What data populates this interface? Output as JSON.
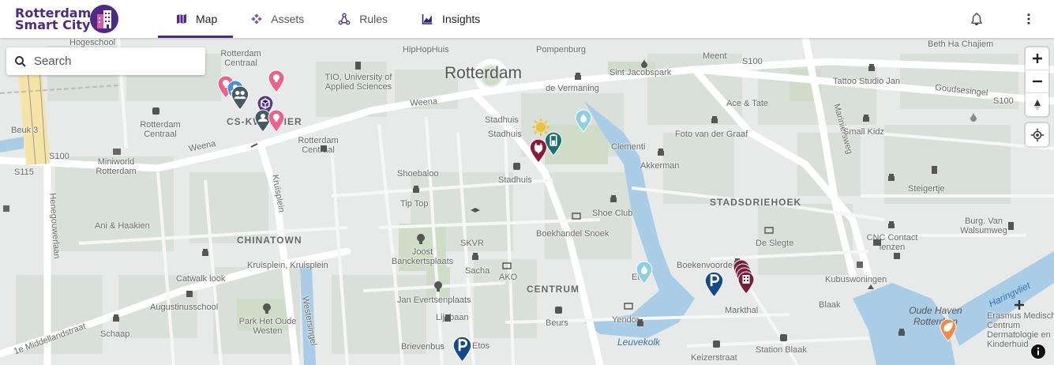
{
  "app": {
    "title_line1": "Rotterdam",
    "title_line2": "Smart City",
    "brand_color": "#4e2a84"
  },
  "nav": {
    "tabs": [
      {
        "label": "Map",
        "icon": "map-icon",
        "active": true
      },
      {
        "label": "Assets",
        "icon": "assets-icon",
        "active": false
      },
      {
        "label": "Rules",
        "icon": "rules-icon",
        "active": false
      },
      {
        "label": "Insights",
        "icon": "insights-icon",
        "active": false
      }
    ]
  },
  "header_right": {
    "notifications_icon": "bell-icon",
    "menu_icon": "more-vert-icon"
  },
  "search": {
    "placeholder": "Search"
  },
  "map": {
    "city_label": "Rotterdam",
    "districts": [
      "CS-KWARTIER",
      "CHINATOWN",
      "CENTRUM",
      "STADSDRIEHOEK"
    ],
    "streets": [
      "Weena",
      "Kruisplein",
      "Henegouwerlaan",
      "Westersingel",
      "1e Middellandstraat",
      "Goudsesingel",
      "Mariniersweg",
      "Haringvliet",
      "Leuvekolk",
      "S100",
      "S115"
    ],
    "places": [
      "Hogeschool",
      "Rotterdam Centraal",
      "HipHopHuis",
      "Pompenburg",
      "Meent",
      "Beth Ha Chajiem",
      "TIO, University of Applied Sciences",
      "de Vermaning",
      "Sint Jacobspark",
      "Tattoo Studio Jan",
      "Ace & Tate",
      "Stadhuis",
      "Clementi",
      "Foto van der Graaf",
      "Akkerman",
      "Small Kidz",
      "Beuk 3",
      "Miniworld Rotterdam",
      "Shoebaloo",
      "Steigertje",
      "Tip Top",
      "Shoe Club",
      "Burg. Van Walsumweg",
      "Ani & Haakien",
      "SKVR",
      "Boekhandel Snoek",
      "De Slegte",
      "CNC Contact lenzen",
      "Joost Banckertsplaats",
      "Kruisplein, Kruisplein",
      "Sacha",
      "AKO",
      "Etos",
      "Boekenvoordeel",
      "Kubuswoningen",
      "Catwalk look",
      "Jan Evertsenplaats",
      "Blaak",
      "Markthal",
      "Augustinusschool",
      "Park Het Oude Westen",
      "Lijnbaan",
      "Yendor",
      "Oude Haven Rotterdam",
      "Erasmus Medisch Centrum Dermatologie en Kinderhuid",
      "Schaap",
      "Brievenbus",
      "Beurs",
      "Station Blaak",
      "Keizerstraat"
    ]
  },
  "markers": [
    {
      "name": "idea",
      "color": "#e8648c",
      "icon": "lightbulb-icon"
    },
    {
      "name": "idea",
      "color": "#e8648c",
      "icon": "lightbulb-icon"
    },
    {
      "name": "idea",
      "color": "#e8648c",
      "icon": "lightbulb-icon"
    },
    {
      "name": "group",
      "color": "#4a90d9",
      "icon": "group-icon"
    },
    {
      "name": "group",
      "color": "#455a64",
      "icon": "group-icon"
    },
    {
      "name": "asset",
      "color": "#5b3a8c",
      "icon": "cube-icon"
    },
    {
      "name": "group",
      "color": "#455a64",
      "icon": "group-icon"
    },
    {
      "name": "weather",
      "color": "#f1c232",
      "icon": "sun-icon"
    },
    {
      "name": "charger",
      "color": "#8b1a3a",
      "icon": "plug-icon"
    },
    {
      "name": "charger",
      "color": "#1f6f6f",
      "icon": "battery-icon"
    },
    {
      "name": "water",
      "color": "#8fcfe0",
      "icon": "water-drop-icon"
    },
    {
      "name": "water",
      "color": "#8fcfe0",
      "icon": "water-drop-icon"
    },
    {
      "name": "parking",
      "color": "#154a8a",
      "icon": "parking-icon"
    },
    {
      "name": "parking",
      "color": "#154a8a",
      "icon": "parking-icon"
    },
    {
      "name": "building",
      "color": "#7a1c3a",
      "icon": "building-icon"
    },
    {
      "name": "environment",
      "color": "#f08a4b",
      "icon": "leaf-icon"
    }
  ],
  "controls": {
    "zoom_in": "zoom-in-icon",
    "zoom_out": "zoom-out-icon",
    "compass": "compass-icon",
    "locate": "locate-icon",
    "attribution": "info-icon"
  }
}
